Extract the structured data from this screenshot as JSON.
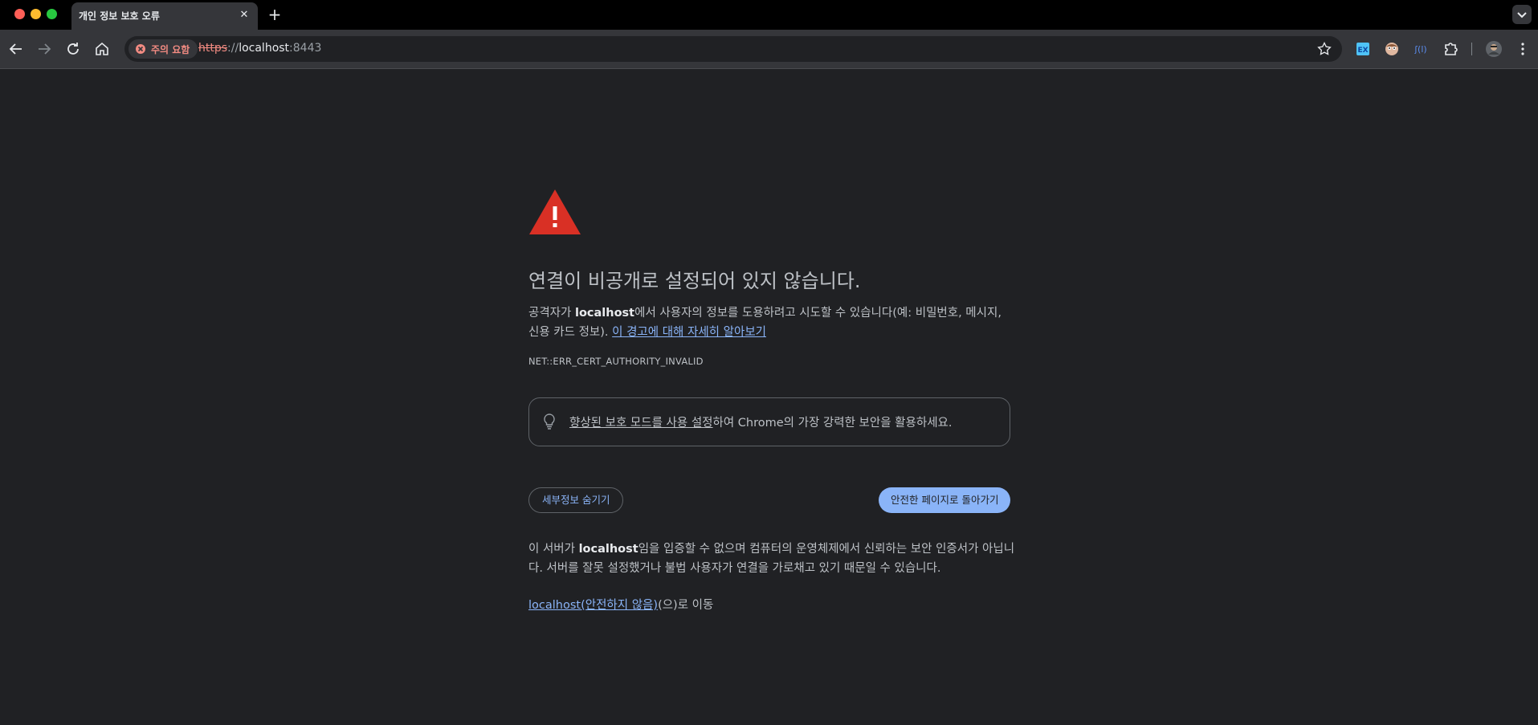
{
  "tab": {
    "title": "개인 정보 보호 오류"
  },
  "toolbar": {
    "security_chip": "주의 요함",
    "url_scheme": "https",
    "url_sep": "://",
    "url_host": "localhost",
    "url_port": ":8443"
  },
  "extensions": [
    "ex-extension-icon",
    "avatar-extension-icon",
    "voice-extension-icon",
    "puzzle-extensions-icon",
    "profile-avatar"
  ],
  "page": {
    "heading": "연결이 비공개로 설정되어 있지 않습니다.",
    "para1_prefix": "공격자가 ",
    "para1_host": "localhost",
    "para1_middle": "에서 사용자의 정보를 도용하려고 시도할 수 있습니다(예: 비밀번호, 메시지, 신용 카드 정보). ",
    "para1_link": "이 경고에 대해 자세히 알아보기",
    "error_code": "NET::ERR_CERT_AUTHORITY_INVALID",
    "enhanced_link": "향상된 보호 모드를 사용 설정",
    "enhanced_suffix": "하여 Chrome의 가장 강력한 보안을 활용하세요.",
    "details_button": "세부정보 숨기기",
    "back_button": "안전한 페이지로 돌아가기",
    "para2_prefix": "이 서버가 ",
    "para2_host": "localhost",
    "para2_suffix": "임을 입증할 수 없으며 컴퓨터의 운영체제에서 신뢰하는 보안 인증서가 아닙니다. 서버를 잘못 설정했거나 불법 사용자가 연결을 가로채고 있기 때문일 수 있습니다.",
    "proceed_link": "localhost(안전하지 않음)",
    "proceed_suffix": "(으)로 이동"
  },
  "colors": {
    "background": "#202124",
    "link": "#8ab4f8",
    "warning_red": "#d93025",
    "danger_text": "#f28b82"
  }
}
